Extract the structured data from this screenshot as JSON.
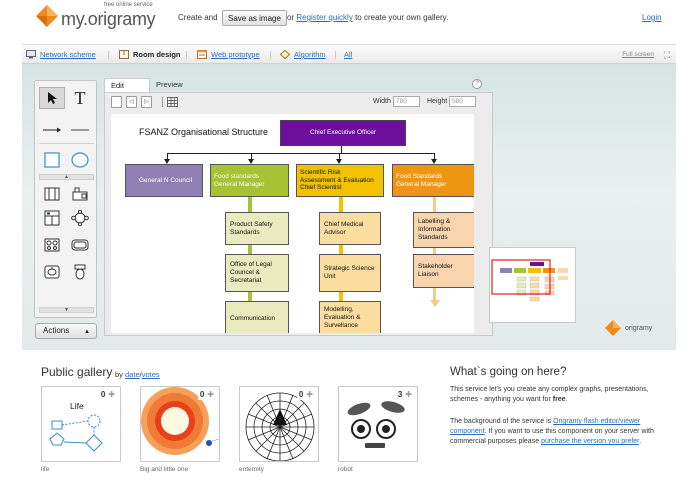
{
  "header": {
    "logo_tagline": "free online service",
    "logo_text": "my.origramy",
    "create_text": "Create and",
    "save_button": "Save as image",
    "or_text": "or",
    "register_link": "Register quickly",
    "register_suffix": "to create your own gallery.",
    "login_link": "Login"
  },
  "nav": {
    "items": [
      "Network scheme",
      "Room design",
      "Web prototype",
      "Algorithm",
      "All"
    ],
    "active": "Room design",
    "fullscreen": "Full screen"
  },
  "editor": {
    "tabs": [
      "Edit",
      "Preview"
    ],
    "active_tab": "Edit",
    "width_label": "Width",
    "width_value": "780",
    "height_label": "Height",
    "height_value": "580",
    "actions_label": "Actions",
    "brand_small": "origramy"
  },
  "org_chart": {
    "title": "FSANZ Organisational Structure",
    "ceo": "Chief Executive Officer",
    "top": [
      {
        "label": "General N Council",
        "color": "#9180b5"
      },
      {
        "label": "Food standards\nGeneral Manager",
        "color": "#a7c232"
      },
      {
        "label": "Scientific Risk\nAssessment & Evaluation\nChief Scientist",
        "color": "#f2c200"
      },
      {
        "label": "Food Standards\nGeneral Manager",
        "color": "#ee9514"
      }
    ],
    "green_children": [
      "Product Safety\nStandards",
      "Office of Legal\nCouncel &\nSecretariat",
      "Communication"
    ],
    "yellow_children": [
      "Chief Medical\nAdvisor",
      "Strategic Science\nUnit",
      "Modelling,\nEvaluation &\nSurvellance"
    ],
    "orange_children": [
      "Labelling &\nInformation\nStandards",
      "Stakeholder\nLiaison"
    ]
  },
  "gallery": {
    "title": "Public gallery",
    "by_text": "by",
    "sort_date": "date",
    "sort_sep": "/",
    "sort_votes": "votes",
    "items": [
      {
        "label": "life",
        "count": "0",
        "preview_title": "Life"
      },
      {
        "label": "Big and little one",
        "count": "0"
      },
      {
        "label": "enternity",
        "count": "0"
      },
      {
        "label": "robot",
        "count": "3"
      }
    ]
  },
  "about": {
    "title": "What`s going on here?",
    "p1_text": "This service let's you create any complex graphs, presentations, schemes - anything you want for",
    "p1_bold": "free",
    "p1_end": ".",
    "p2_start": "The background of the service is",
    "p2_link1": "Origramy flash editor/viewer component",
    "p2_mid": ". If you want to use this component on your server with commercial purposes please",
    "p2_link2": "purchase the version you prefer",
    "p2_end": "."
  },
  "colors": {
    "accent_orange": "#f08a1c",
    "ceo_purple": "#6e0e9c",
    "link_blue": "#2a6ebb"
  }
}
